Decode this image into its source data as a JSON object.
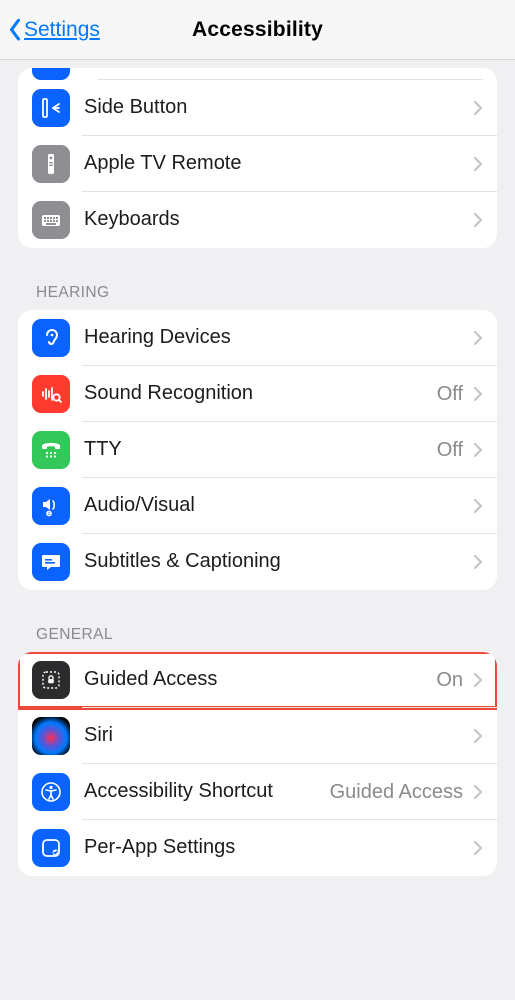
{
  "nav": {
    "back_label": "Settings",
    "title": "Accessibility"
  },
  "sections": {
    "top_partial": {
      "rows": [
        {
          "label": "Side Button"
        },
        {
          "label": "Apple TV Remote"
        },
        {
          "label": "Keyboards"
        }
      ]
    },
    "hearing": {
      "header": "HEARING",
      "rows": [
        {
          "label": "Hearing Devices",
          "detail": ""
        },
        {
          "label": "Sound Recognition",
          "detail": "Off"
        },
        {
          "label": "TTY",
          "detail": "Off"
        },
        {
          "label": "Audio/Visual",
          "detail": ""
        },
        {
          "label": "Subtitles & Captioning",
          "detail": ""
        }
      ]
    },
    "general": {
      "header": "GENERAL",
      "rows": [
        {
          "label": "Guided Access",
          "detail": "On",
          "highlighted": true
        },
        {
          "label": "Siri",
          "detail": ""
        },
        {
          "label": "Accessibility Shortcut",
          "detail": "Guided Access"
        },
        {
          "label": "Per-App Settings",
          "detail": ""
        }
      ]
    }
  }
}
